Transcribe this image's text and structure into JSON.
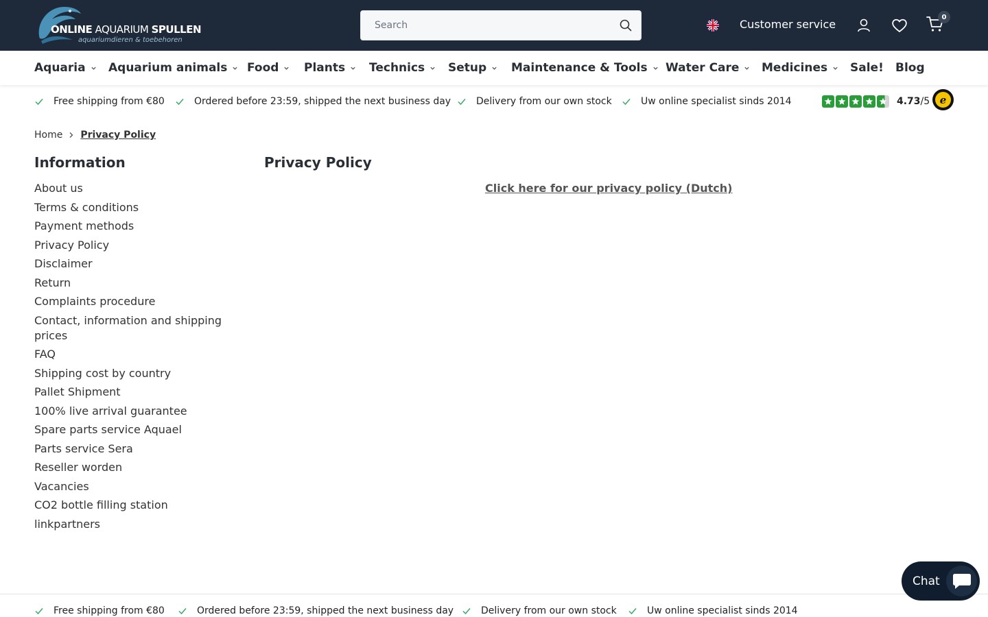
{
  "header": {
    "logo_main_bold": "ONLINE",
    "logo_main_thin": " AQUARIUM ",
    "logo_main_end": "SPULLEN",
    "logo_sub": "aquariumdieren & toebehoren",
    "search_placeholder": "Search",
    "customer_service": "Customer service",
    "cart_count": "0"
  },
  "nav": {
    "items": [
      {
        "label": "Aquaria",
        "dropdown": true
      },
      {
        "label": "Aquarium animals",
        "dropdown": true
      },
      {
        "label": "Food",
        "dropdown": true
      },
      {
        "label": "Plants",
        "dropdown": true
      },
      {
        "label": "Technics",
        "dropdown": true
      },
      {
        "label": "Setup",
        "dropdown": true
      },
      {
        "label": "Maintenance & Tools",
        "dropdown": true
      },
      {
        "label": "Water Care",
        "dropdown": true
      },
      {
        "label": "Medicines",
        "dropdown": true
      },
      {
        "label": "Sale!",
        "dropdown": false
      },
      {
        "label": "Blog",
        "dropdown": false
      }
    ]
  },
  "usp": {
    "items": [
      "Free shipping from €80",
      "Ordered before 23:59, shipped the next business day",
      "Delivery from our own stock",
      "Uw online specialist sinds 2014"
    ]
  },
  "rating": {
    "score": "4.73",
    "max": "/5",
    "stars": 4.73
  },
  "breadcrumb": {
    "home": "Home",
    "current": "Privacy Policy"
  },
  "sidebar": {
    "title": "Information",
    "items": [
      "About us",
      "Terms & conditions",
      "Payment methods",
      "Privacy Policy",
      "Disclaimer",
      "Return",
      "Complaints procedure",
      "Contact, information and shipping prices",
      "FAQ",
      "Shipping cost by country",
      "Pallet Shipment",
      "100% live arrival guarantee",
      "Spare parts service Aquael",
      "Parts service Sera",
      "Reseller worden",
      "Vacancies",
      "CO2 bottle filling station",
      "linkpartners"
    ]
  },
  "main": {
    "title": "Privacy Policy",
    "link": "Click here for our privacy policy (Dutch)"
  },
  "chat": {
    "label": "Chat"
  },
  "colors": {
    "header_bg": "#1e2a3a",
    "check_green": "#3aaa6a",
    "star_green": "#2a9d3a"
  }
}
